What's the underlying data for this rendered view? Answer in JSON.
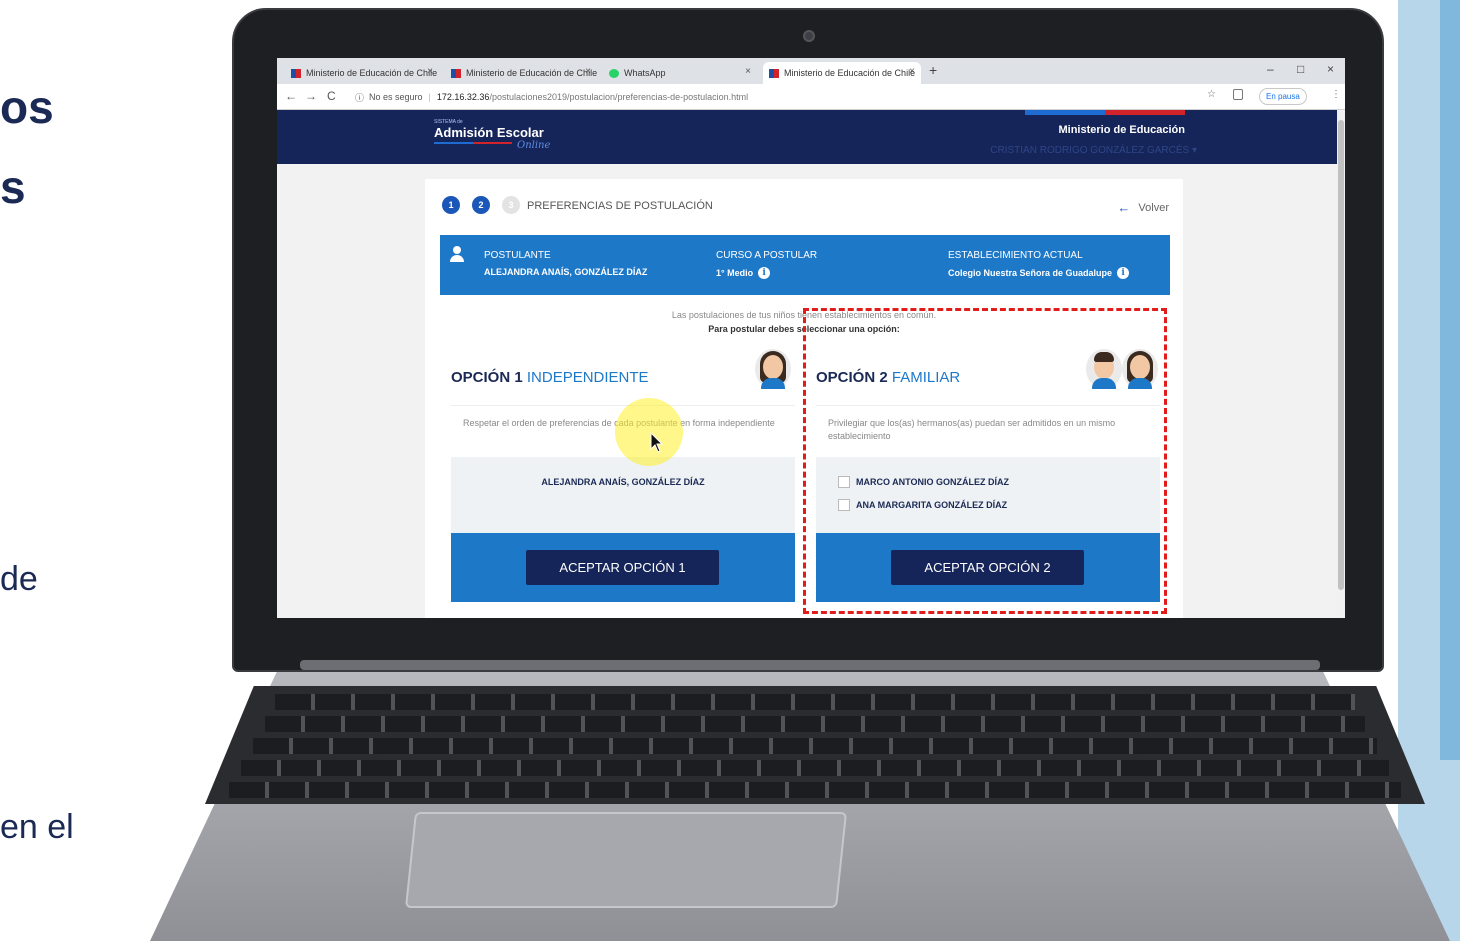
{
  "slide": {
    "line1": "os",
    "line2": "s",
    "line3": "de",
    "line4": "en el"
  },
  "browser": {
    "tabs": [
      {
        "label": "Ministerio de Educación de Chile",
        "close": "×",
        "icon": "mineduc-favicon"
      },
      {
        "label": "Ministerio de Educación de Chile",
        "close": "×",
        "icon": "mineduc-favicon"
      },
      {
        "label": "WhatsApp",
        "close": "×",
        "icon": "whatsapp-favicon"
      },
      {
        "label": "Ministerio de Educación de Chile",
        "close": "×",
        "icon": "mineduc-favicon"
      }
    ],
    "new_tab": "+",
    "window_controls": {
      "minimize": "–",
      "maximize": "□",
      "close": "×"
    },
    "nav": {
      "back": "←",
      "forward": "→",
      "reload": "C",
      "info": "ⓘ"
    },
    "security_label": "No es seguro",
    "url_host": "172.16.32.36",
    "url_path": "/postulaciones2019/postulacion/preferencias-de-postulacion.html",
    "paused_label": "En pausa",
    "menu": "⋮",
    "star": "☆"
  },
  "site": {
    "logo_small": "SISTEMA de",
    "logo_main": "Admisión Escolar",
    "logo_online": "Online",
    "ministry": "Ministerio de Educación",
    "user_name": "CRISTIAN RODRIGO GONZÁLEZ GARCÉS ▾"
  },
  "card": {
    "steps": [
      "1",
      "2",
      "3"
    ],
    "title": "PREFERENCIAS DE POSTULACIÓN",
    "back_label": "Volver",
    "summary": {
      "applicant_label": "POSTULANTE",
      "applicant_value": "ALEJANDRA ANAÍS, GONZÁLEZ DÍAZ",
      "course_label": "CURSO A POSTULAR",
      "course_value": "1° Medio",
      "school_label": "ESTABLECIMIENTO ACTUAL",
      "school_value": "Colegio Nuestra Señora de Guadalupe"
    },
    "notice_line1": "Las postulaciones de tus niños tienen establecimientos en común.",
    "notice_line2": "Para postular debes seleccionar una opción:",
    "option1": {
      "number": "OPCIÓN 1",
      "name": "INDEPENDIENTE",
      "description": "Respetar el orden de preferencias de cada postulante en forma independiente",
      "student": "ALEJANDRA ANAÍS, GONZÁLEZ DÍAZ",
      "button": "ACEPTAR OPCIÓN 1"
    },
    "option2": {
      "number": "OPCIÓN 2",
      "name": "FAMILIAR",
      "description": "Privilegiar que los(as) hermanos(as) puedan ser admitidos en un mismo establecimiento",
      "siblings": [
        "MARCO ANTONIO GONZÁLEZ DÍAZ",
        "ANA MARGARITA GONZÁLEZ DÍAZ"
      ],
      "button": "ACEPTAR OPCIÓN 2"
    }
  },
  "colors": {
    "header_navy": "#15255a",
    "accent_blue": "#1e78c8",
    "highlight_red": "#e21b1b"
  }
}
